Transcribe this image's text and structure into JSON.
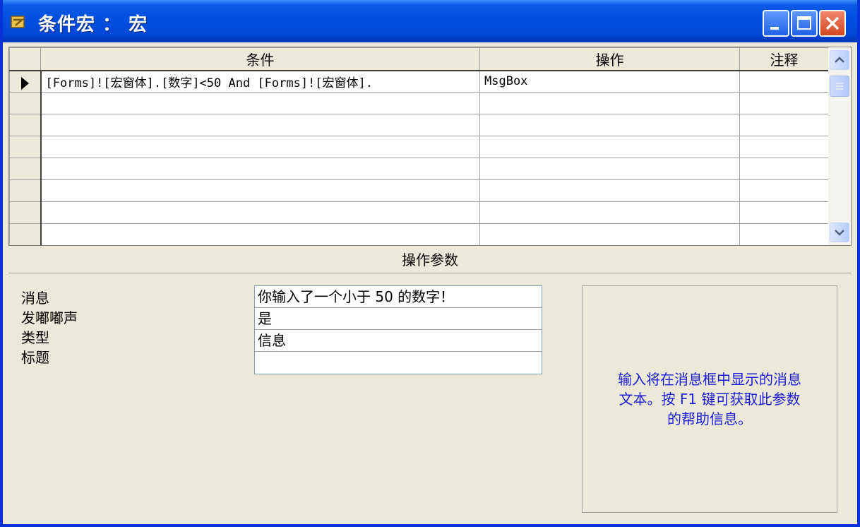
{
  "window": {
    "title": "条件宏 ： 宏"
  },
  "grid": {
    "columns": [
      "条件",
      "操作",
      "注释"
    ],
    "rows": [
      {
        "condition": "[Forms]![宏窗体].[数字]<50 And [Forms]![宏窗体].",
        "action": "MsgBox",
        "comment": ""
      }
    ]
  },
  "params": {
    "header": "操作参数",
    "fields": [
      {
        "label": "消息",
        "value": "你输入了一个小于 50 的数字！"
      },
      {
        "label": "发嘟嘟声",
        "value": "是"
      },
      {
        "label": "类型",
        "value": "信息"
      },
      {
        "label": "标题",
        "value": ""
      }
    ],
    "help_lines": [
      "输入将在消息框中显示的消息",
      "文本。按 F1 键可获取此参数",
      "的帮助信息。"
    ]
  }
}
